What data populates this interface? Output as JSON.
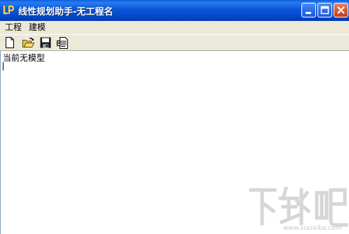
{
  "window": {
    "title": "线性规划助手-无工程名",
    "icon": "app-lp-icon",
    "controls": [
      "minimize-icon",
      "maximize-icon",
      "close-icon"
    ]
  },
  "menu": {
    "items": [
      {
        "label": "工程"
      },
      {
        "label": "建模"
      }
    ]
  },
  "toolbar": {
    "buttons": [
      {
        "icon": "new-file-icon"
      },
      {
        "icon": "open-folder-icon"
      },
      {
        "icon": "save-disk-icon"
      },
      {
        "icon": "properties-icon"
      }
    ]
  },
  "editor": {
    "text": "当前无模型"
  },
  "watermark": {
    "logo": "下载吧",
    "site": "www.xiazaiba.com"
  },
  "colors": {
    "titlebar": "#0b56d8",
    "menubar": "#ece9d8",
    "editor_bg": "#ffffff"
  }
}
